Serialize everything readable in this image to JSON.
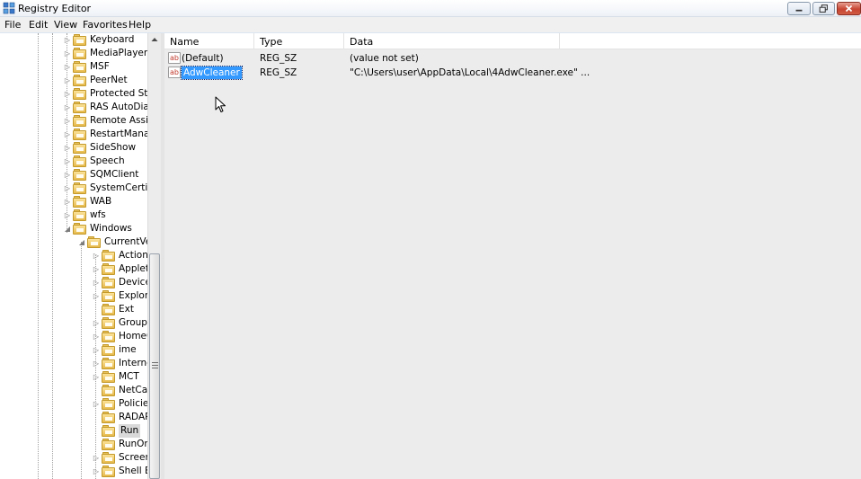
{
  "window": {
    "title": "Registry Editor"
  },
  "menu": [
    "File",
    "Edit",
    "View",
    "Favorites",
    "Help"
  ],
  "tree": {
    "nodes": [
      {
        "label": "Keyboard",
        "depth": 3,
        "expander": "collapsed"
      },
      {
        "label": "MediaPlayer",
        "depth": 3,
        "expander": "collapsed"
      },
      {
        "label": "MSF",
        "depth": 3,
        "expander": "collapsed"
      },
      {
        "label": "PeerNet",
        "depth": 3,
        "expander": "collapsed"
      },
      {
        "label": "Protected Stor",
        "depth": 3,
        "expander": "collapsed"
      },
      {
        "label": "RAS AutoDial",
        "depth": 3,
        "expander": "collapsed"
      },
      {
        "label": "Remote Assista",
        "depth": 3,
        "expander": "collapsed"
      },
      {
        "label": "RestartManage",
        "depth": 3,
        "expander": "collapsed"
      },
      {
        "label": "SideShow",
        "depth": 3,
        "expander": "collapsed"
      },
      {
        "label": "Speech",
        "depth": 3,
        "expander": "collapsed"
      },
      {
        "label": "SQMClient",
        "depth": 3,
        "expander": "collapsed"
      },
      {
        "label": "SystemCertific",
        "depth": 3,
        "expander": "collapsed"
      },
      {
        "label": "WAB",
        "depth": 3,
        "expander": "collapsed"
      },
      {
        "label": "wfs",
        "depth": 3,
        "expander": "collapsed"
      },
      {
        "label": "Windows",
        "depth": 3,
        "expander": "expanded"
      },
      {
        "label": "CurrentVer",
        "depth": 4,
        "expander": "expanded"
      },
      {
        "label": "Action",
        "depth": 5,
        "expander": "collapsed"
      },
      {
        "label": "Applets",
        "depth": 5,
        "expander": "collapsed"
      },
      {
        "label": "Device",
        "depth": 5,
        "expander": "collapsed"
      },
      {
        "label": "Explore",
        "depth": 5,
        "expander": "collapsed"
      },
      {
        "label": "Ext",
        "depth": 5,
        "expander": "none"
      },
      {
        "label": "Group I",
        "depth": 5,
        "expander": "collapsed"
      },
      {
        "label": "HomeG",
        "depth": 5,
        "expander": "collapsed"
      },
      {
        "label": "ime",
        "depth": 5,
        "expander": "collapsed"
      },
      {
        "label": "Interne",
        "depth": 5,
        "expander": "collapsed"
      },
      {
        "label": "MCT",
        "depth": 5,
        "expander": "collapsed"
      },
      {
        "label": "NetCac",
        "depth": 5,
        "expander": "none"
      },
      {
        "label": "Policies",
        "depth": 5,
        "expander": "collapsed"
      },
      {
        "label": "RADAR",
        "depth": 5,
        "expander": "none"
      },
      {
        "label": "Run",
        "depth": 5,
        "expander": "none",
        "selected": true
      },
      {
        "label": "RunOn",
        "depth": 5,
        "expander": "none"
      },
      {
        "label": "Screens",
        "depth": 5,
        "expander": "collapsed"
      },
      {
        "label": "Shell Ex",
        "depth": 5,
        "expander": "collapsed"
      }
    ]
  },
  "list": {
    "columns": {
      "name": "Name",
      "type": "Type",
      "data": "Data"
    },
    "rows": [
      {
        "icon": "string-value-icon",
        "icon_text": "ab",
        "name": "(Default)",
        "type": "REG_SZ",
        "data": "(value not set)",
        "selected": false
      },
      {
        "icon": "string-value-icon",
        "icon_text": "ab",
        "name": "AdwCleaner",
        "type": "REG_SZ",
        "data": "\"C:\\Users\\user\\AppData\\Local\\4AdwCleaner.exe\" ...",
        "selected": true
      }
    ]
  },
  "colors": {
    "selection": "#3399ff",
    "folder": "#e7b94c",
    "tree_selection": "#d9d9d9"
  }
}
